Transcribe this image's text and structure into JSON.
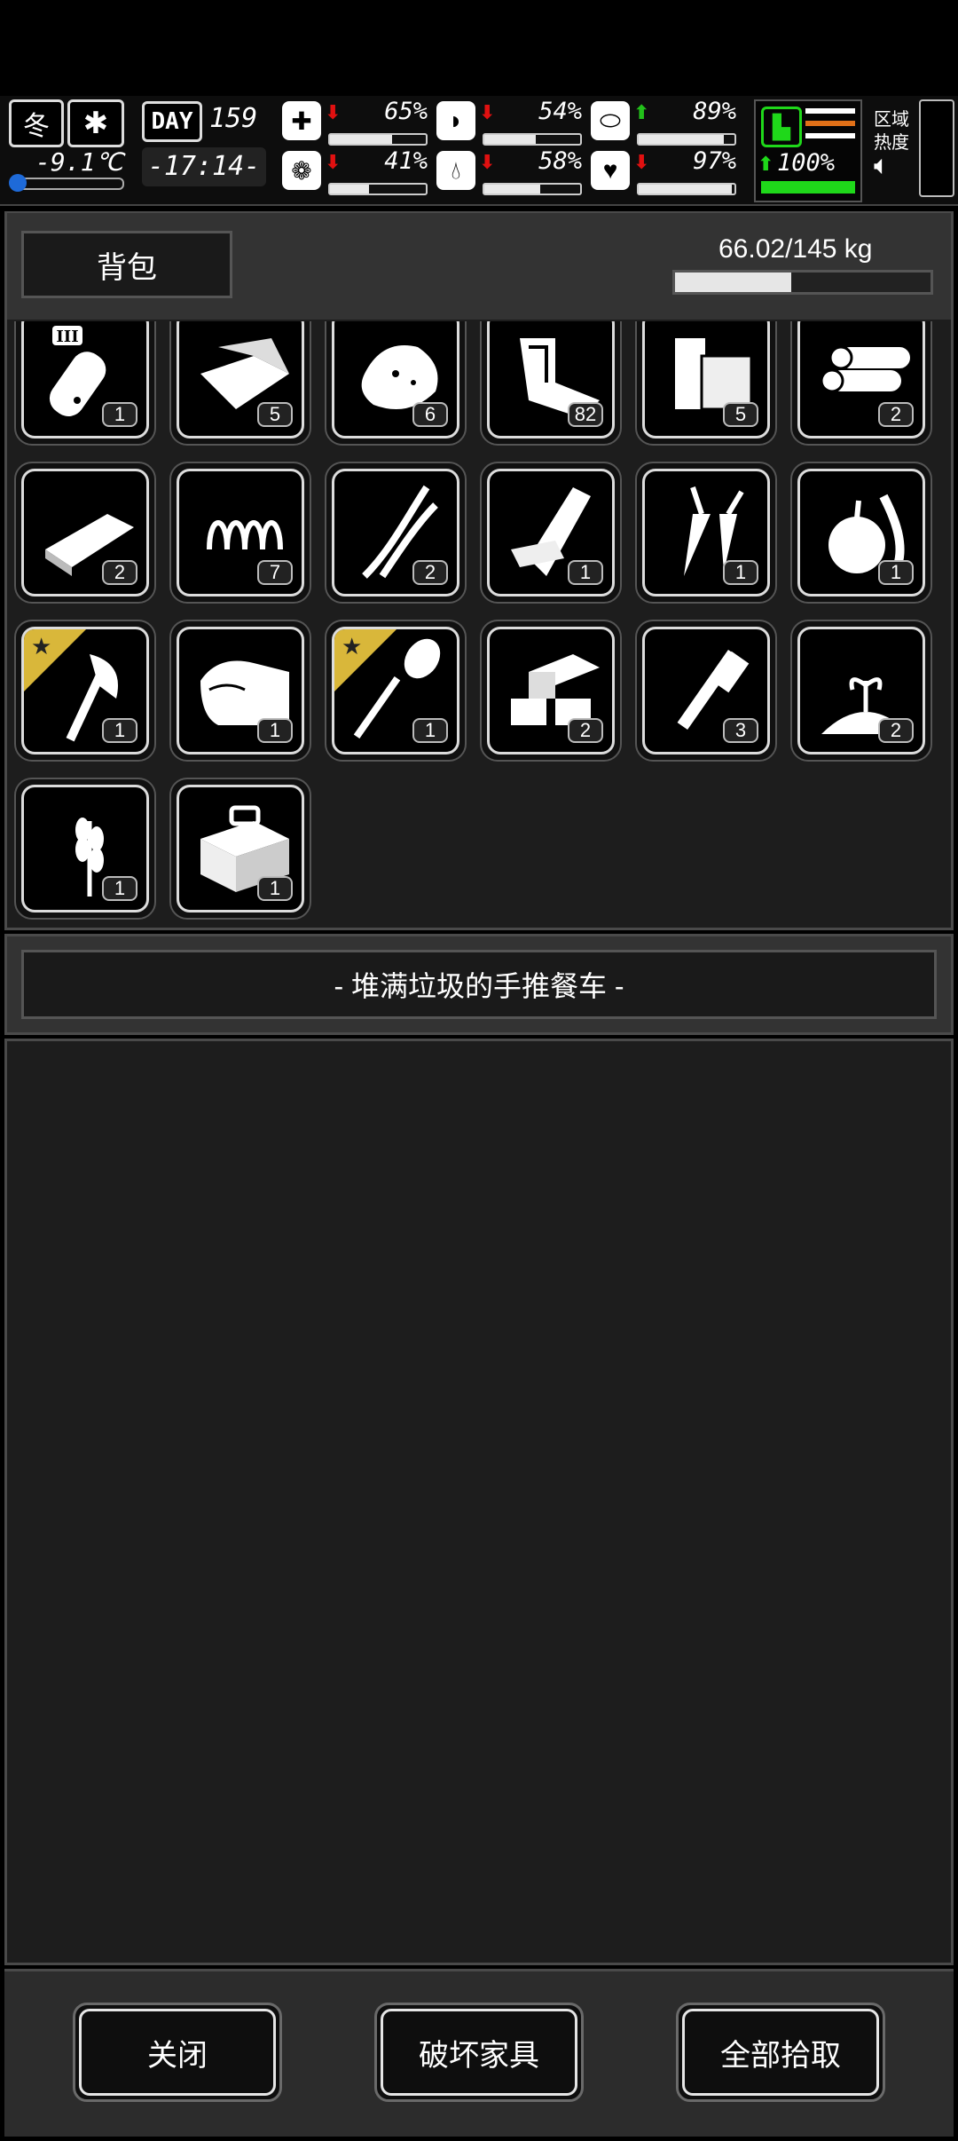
{
  "hud": {
    "season": "冬",
    "temperature": "-9.1℃",
    "day_label": "DAY",
    "day_number": "159",
    "time": "-17:14-",
    "stats": [
      {
        "name": "health",
        "icon": "medkit-icon",
        "trend": "down",
        "value": "65%",
        "fraction": 0.65
      },
      {
        "name": "hunger",
        "icon": "stomach-icon",
        "trend": "down",
        "value": "54%",
        "fraction": 0.54
      },
      {
        "name": "energy",
        "icon": "pill-icon",
        "trend": "up",
        "value": "89%",
        "fraction": 0.89
      },
      {
        "name": "mind",
        "icon": "brain-icon",
        "trend": "down",
        "value": "41%",
        "fraction": 0.41
      },
      {
        "name": "thirst",
        "icon": "water-drop-icon",
        "trend": "down",
        "value": "58%",
        "fraction": 0.58
      },
      {
        "name": "mood",
        "icon": "heart-icon",
        "trend": "down",
        "value": "97%",
        "fraction": 0.97
      }
    ],
    "stamina": {
      "value": "100%",
      "fraction": 1.0,
      "trend": "up"
    },
    "area_heat_label_1": "区域",
    "area_heat_label_2": "热度",
    "colors": {
      "up": "#22c01a",
      "down": "#e01010",
      "stamina": "#1fd81a",
      "accent_orange": "#e07018"
    }
  },
  "backpack": {
    "title": "背包",
    "weight": "66.02/145 kg",
    "weight_fraction": 0.455
  },
  "items": [
    {
      "icon": "test-tube-icon",
      "count": "1",
      "badge": false
    },
    {
      "icon": "cloth-icon",
      "count": "5",
      "badge": false
    },
    {
      "icon": "meat-icon",
      "count": "6",
      "badge": false
    },
    {
      "icon": "scrap-metal-icon",
      "count": "82",
      "badge": false
    },
    {
      "icon": "wood-planks-icon",
      "count": "5",
      "badge": false
    },
    {
      "icon": "logs-icon",
      "count": "2",
      "badge": false
    },
    {
      "icon": "whetstone-icon",
      "count": "2",
      "badge": false
    },
    {
      "icon": "spring-icon",
      "count": "7",
      "badge": false
    },
    {
      "icon": "wires-icon",
      "count": "2",
      "badge": false
    },
    {
      "icon": "broken-board-icon",
      "count": "1",
      "badge": false
    },
    {
      "icon": "carrot-icon",
      "count": "1",
      "badge": false
    },
    {
      "icon": "fruit-icon",
      "count": "1",
      "badge": false
    },
    {
      "icon": "axe-icon",
      "count": "1",
      "badge": true
    },
    {
      "icon": "towel-icon",
      "count": "1",
      "badge": false
    },
    {
      "icon": "shovel-icon",
      "count": "1",
      "badge": true
    },
    {
      "icon": "bricks-icon",
      "count": "2",
      "badge": false
    },
    {
      "icon": "wrench-icon",
      "count": "3",
      "badge": false
    },
    {
      "icon": "sprout-soil-icon",
      "count": "2",
      "badge": false
    },
    {
      "icon": "wheat-icon",
      "count": "1",
      "badge": false
    },
    {
      "icon": "toolbox-icon",
      "count": "1",
      "badge": false
    }
  ],
  "container": {
    "title": "- 堆满垃圾的手推餐车 -"
  },
  "actions": {
    "close": "关闭",
    "destroy_furniture": "破坏家具",
    "pick_up_all": "全部拾取"
  }
}
